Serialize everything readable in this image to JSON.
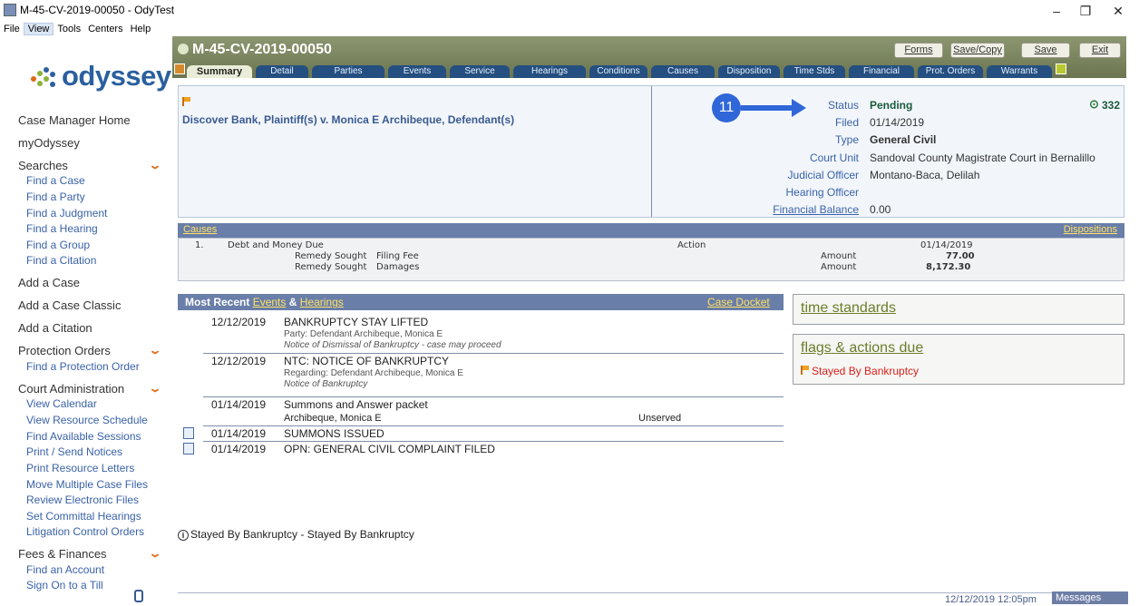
{
  "window": {
    "title": "M-45-CV-2019-00050 - OdyTest",
    "icon": "app-icon",
    "controls": [
      "–",
      "❐",
      "✕"
    ]
  },
  "menu": [
    "File",
    "View",
    "Tools",
    "Centers",
    "Help"
  ],
  "logo": {
    "text": "odyssey",
    "colors": [
      "#e06a16",
      "#8bb23a",
      "#2b5f9e"
    ]
  },
  "sidebar": {
    "home": "Case Manager Home",
    "my": "myOdyssey",
    "searches": {
      "label": "Searches",
      "items": [
        "Find a Case",
        "Find a Party",
        "Find a Judgment",
        "Find a Hearing",
        "Find a Group",
        "Find a Citation"
      ]
    },
    "add_case": "Add a Case",
    "add_case_classic": "Add a Case Classic",
    "add_citation": "Add a Citation",
    "protection": {
      "label": "Protection Orders",
      "items": [
        "Find a Protection Order"
      ]
    },
    "court_admin": {
      "label": "Court Administration",
      "items": [
        "View Calendar",
        "View Resource Schedule",
        "Find Available Sessions",
        "Print / Send Notices",
        "Print Resource Letters",
        "Move Multiple Case Files",
        "Review Electronic Files",
        "Set Committal Hearings",
        "Litigation Control Orders"
      ]
    },
    "fees": {
      "label": "Fees & Finances",
      "items": [
        "Find an Account",
        "Sign On to a Till"
      ]
    }
  },
  "case": {
    "number": "M-45-CV-2019-00050",
    "buttons": {
      "forms": "Forms",
      "save_copy": "Save/Copy",
      "save": "Save",
      "exit": "Exit"
    },
    "tabs": [
      "Summary",
      "Detail",
      "Parties",
      "Events",
      "Service",
      "Hearings",
      "Conditions",
      "Causes",
      "Disposition",
      "Time Stds",
      "Financial",
      "Prot. Orders",
      "Warrants"
    ],
    "active_tab": "Summary"
  },
  "summary": {
    "title": "Discover Bank, Plaintiff(s) v. Monica E Archibeque, Defendant(s)",
    "annotation": "11",
    "days": "332",
    "fields": [
      {
        "label": "Status",
        "value": "Pending"
      },
      {
        "label": "Filed",
        "value": "01/14/2019"
      },
      {
        "label": "Type",
        "value": "General Civil"
      },
      {
        "label": "Court Unit",
        "value": "Sandoval County Magistrate Court in Bernalillo"
      },
      {
        "label": "Judicial Officer",
        "value": "Montano-Baca, Delilah"
      },
      {
        "label": "Hearing Officer",
        "value": ""
      },
      {
        "label": "Financial Balance",
        "value": "0.00"
      }
    ]
  },
  "causes": {
    "header": "Causes",
    "dispositions": "Dispositions",
    "row": {
      "num": "1.",
      "desc": "Debt and Money Due",
      "type": "Action",
      "date": "01/14/2019"
    },
    "remedies": [
      {
        "label": "Remedy Sought",
        "value": "Filing Fee",
        "amount_label": "Amount",
        "amount": "77.00"
      },
      {
        "label": "Remedy Sought",
        "value": "Damages",
        "amount_label": "Amount",
        "amount": "8,172.30"
      }
    ]
  },
  "recent": {
    "prefix": "Most Recent",
    "events_link": "Events",
    "amp": "&",
    "hearings_link": "Hearings",
    "docket": "Case Docket",
    "events": [
      {
        "date": "12/12/2019",
        "title": "BANKRUPTCY STAY LIFTED",
        "sub1": "Party: Defendant Archibeque, Monica E",
        "sub2": "Notice of Dismissal of Bankruptcy - case may proceed"
      },
      {
        "date": "12/12/2019",
        "title": "NTC: NOTICE OF BANKRUPTCY",
        "sub1": "Regarding: Defendant Archibeque, Monica E",
        "sub2": "Notice of Bankruptcy"
      },
      {
        "date": "01/14/2019",
        "title": "Summons and Answer packet",
        "sub1": "Archibeque, Monica E",
        "status": "Unserved"
      },
      {
        "date": "01/14/2019",
        "title": "SUMMONS ISSUED"
      },
      {
        "date": "01/14/2019",
        "title": "OPN: GENERAL CIVIL COMPLAINT FILED"
      }
    ]
  },
  "panels": {
    "time_standards": "time standards",
    "flags_title": "flags",
    "flags_amp": "&",
    "actions_title": "actions due",
    "flag_item": "Stayed By Bankruptcy"
  },
  "footer": {
    "stayed": "Stayed By Bankruptcy - Stayed By Bankruptcy",
    "clock": "12/12/2019 12:05pm",
    "messages": "Messages"
  }
}
